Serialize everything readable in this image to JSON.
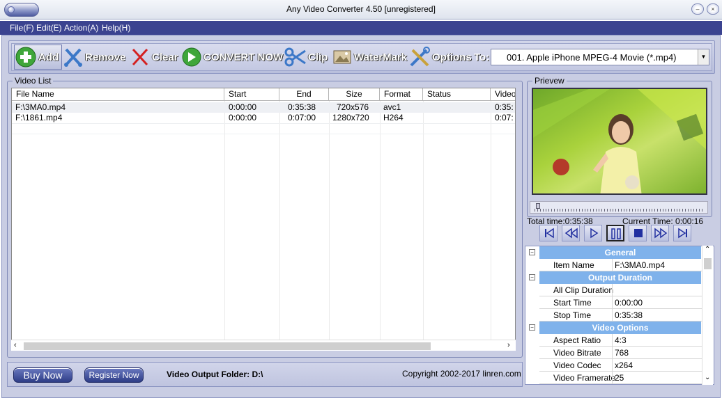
{
  "window": {
    "title": "Any Video Converter 4.50 [unregistered]"
  },
  "menu": [
    "File(F)",
    "Edit(E)",
    "Action(A)",
    "Help(H)"
  ],
  "toolbar": {
    "add": "Add",
    "remove": "Remove",
    "clear": "Clear",
    "convert": "CONVERT NOW",
    "clip": "Clip",
    "watermark": "WaterMark",
    "options": "Options",
    "to": "To:",
    "format": "001.  Apple iPhone MPEG-4 Movie (*.mp4)"
  },
  "video_list": {
    "title": "Video List",
    "columns": [
      "File Name",
      "Start",
      "End",
      "Size",
      "Format",
      "Status",
      "Video"
    ],
    "rows": [
      {
        "name": "F:\\3MA0.mp4",
        "start": "0:00:00",
        "end": "0:35:38",
        "size": "720x576",
        "format": "avc1",
        "status": "",
        "video": "0:35:"
      },
      {
        "name": "F:\\1861.mp4",
        "start": "0:00:00",
        "end": "0:07:00",
        "size": "1280x720",
        "format": "H264",
        "status": "",
        "video": "0:07:"
      }
    ]
  },
  "bottom": {
    "buy": "Buy Now",
    "register": "Register Now",
    "output_folder": "Video Output Folder: D:\\",
    "copyright": "Copyright 2002-2017 linren.com"
  },
  "preview": {
    "title": "Prievew",
    "total_time": "Total time:0:35:38",
    "current_time": "Current Time:   0:00:16",
    "seek_position": 0.01
  },
  "properties": [
    {
      "type": "category",
      "label": "General"
    },
    {
      "type": "item",
      "label": "Item Name",
      "value": "F:\\3MA0.mp4"
    },
    {
      "type": "category",
      "label": "Output Duration"
    },
    {
      "type": "item",
      "label": "All Clip Duration",
      "value": ""
    },
    {
      "type": "item",
      "label": "Start Time",
      "value": "0:00:00"
    },
    {
      "type": "item",
      "label": "Stop Time",
      "value": "0:35:38"
    },
    {
      "type": "category",
      "label": "Video Options"
    },
    {
      "type": "item",
      "label": "Aspect Ratio",
      "value": "4:3"
    },
    {
      "type": "item",
      "label": "Video Bitrate",
      "value": "768"
    },
    {
      "type": "item",
      "label": "Video Codec",
      "value": "x264"
    },
    {
      "type": "item",
      "label": "Video Framerate",
      "value": "25"
    }
  ],
  "colors": {
    "menubar": "#3b4390",
    "frame": "#c9cde3",
    "category": "#7fb2eb",
    "button": "#2e3d87"
  }
}
